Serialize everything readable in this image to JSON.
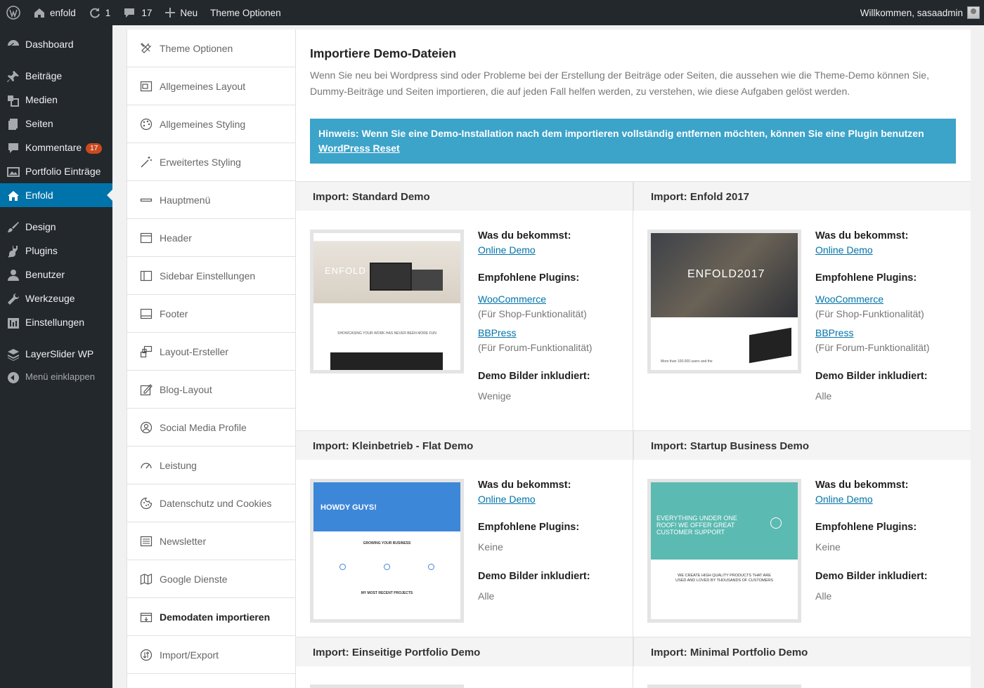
{
  "adminbar": {
    "site_name": "enfold",
    "updates_count": "1",
    "comments_count": "17",
    "new_label": "Neu",
    "theme_options_label": "Theme Optionen",
    "welcome": "Willkommen, sasaadmin"
  },
  "menu": [
    {
      "label": "Dashboard",
      "icon": "dashboard-icon"
    },
    {
      "label": "Beiträge",
      "icon": "pin-icon"
    },
    {
      "label": "Medien",
      "icon": "media-icon"
    },
    {
      "label": "Seiten",
      "icon": "pages-icon"
    },
    {
      "label": "Kommentare",
      "icon": "comment-icon",
      "badge": "17"
    },
    {
      "label": "Portfolio Einträge",
      "icon": "portfolio-icon"
    },
    {
      "label": "Enfold",
      "icon": "home-icon",
      "active": true
    },
    {
      "label": "Design",
      "icon": "brush-icon"
    },
    {
      "label": "Plugins",
      "icon": "plugin-icon"
    },
    {
      "label": "Benutzer",
      "icon": "user-icon"
    },
    {
      "label": "Werkzeuge",
      "icon": "wrench-icon"
    },
    {
      "label": "Einstellungen",
      "icon": "settings-icon"
    },
    {
      "label": "LayerSlider WP",
      "icon": "layers-icon"
    },
    {
      "label": "Menü einklappen",
      "icon": "collapse-icon"
    }
  ],
  "options_nav": [
    {
      "label": "Theme Optionen",
      "icon": "tools-icon"
    },
    {
      "label": "Allgemeines Layout",
      "icon": "layout-icon"
    },
    {
      "label": "Allgemeines Styling",
      "icon": "palette-icon"
    },
    {
      "label": "Erweitertes Styling",
      "icon": "magic-wand-icon"
    },
    {
      "label": "Hauptmenü",
      "icon": "menu-bar-icon"
    },
    {
      "label": "Header",
      "icon": "header-icon"
    },
    {
      "label": "Sidebar Einstellungen",
      "icon": "sidebar-icon"
    },
    {
      "label": "Footer",
      "icon": "footer-icon"
    },
    {
      "label": "Layout-Ersteller",
      "icon": "layout-builder-icon"
    },
    {
      "label": "Blog-Layout",
      "icon": "blog-icon"
    },
    {
      "label": "Social Media Profile",
      "icon": "social-icon"
    },
    {
      "label": "Leistung",
      "icon": "speedometer-icon"
    },
    {
      "label": "Datenschutz und Cookies",
      "icon": "cookie-icon"
    },
    {
      "label": "Newsletter",
      "icon": "newsletter-icon"
    },
    {
      "label": "Google Dienste",
      "icon": "map-icon"
    },
    {
      "label": "Demodaten importieren",
      "icon": "import-icon",
      "active": true
    },
    {
      "label": "Import/Export",
      "icon": "import-export-icon"
    }
  ],
  "page": {
    "title": "Importiere Demo-Dateien",
    "intro": "Wenn Sie neu bei Wordpress sind oder Probleme bei der Erstellung der Beiträge oder Seiten, die aussehen wie die Theme-Demo können Sie, Dummy-Beiträge und Seiten importieren, die auf jeden Fall helfen werden, zu verstehen, wie diese Aufgaben gelöst werden.",
    "notice_text": "Hinweis: Wenn Sie eine Demo-Installation nach dem importieren vollständig entfernen möchten, können Sie eine Plugin benutzen ",
    "notice_link": "WordPress Reset"
  },
  "labels": {
    "you_get": "Was du bekommst:",
    "online_demo": "Online Demo",
    "recommended_plugins": "Empfohlene Plugins:",
    "demo_images": "Demo Bilder inkludiert:"
  },
  "demos": [
    {
      "title": "Import: Standard Demo",
      "plugins": [
        {
          "name": "WooCommerce",
          "note": "(Für Shop-Funktionalität)"
        },
        {
          "name": "BBPress",
          "note": "(Für Forum-Funktionalität)"
        }
      ],
      "images": "Wenige",
      "thumb_text": "ENFOLD",
      "thumb_sub": "SHOWCASING YOUR WORK HAS NEVER BEEN MORE FUN"
    },
    {
      "title": "Import: Enfold 2017",
      "plugins": [
        {
          "name": "WooCommerce",
          "note": "(Für Shop-Funktionalität)"
        },
        {
          "name": "BBPress",
          "note": "(Für Forum-Funktionalität)"
        }
      ],
      "images": "Alle",
      "thumb_text": "ENFOLD2017",
      "thumb_sub": "More than 100.000 users and the"
    },
    {
      "title": "Import: Kleinbetrieb - Flat Demo",
      "plugins_none": "Keine",
      "images": "Alle",
      "thumb_text": "HOWDY GUYS!",
      "thumb_sub": "GROWING YOUR BUSINESS",
      "thumb_sub2": "MY MOST RECENT PROJECTS"
    },
    {
      "title": "Import: Startup Business Demo",
      "plugins_none": "Keine",
      "images": "Alle",
      "thumb_text": "EVERYTHING UNDER ONE ROOF! WE OFFER GREAT CUSTOMER SUPPORT",
      "thumb_sub": "WE CREATE HIGH QUALITY PRODUCTS THAT ARE USED AND LOVED BY THOUSANDS OF CUSTOMERS"
    },
    {
      "title": "Import: Einseitige Portfolio Demo"
    },
    {
      "title": "Import: Minimal Portfolio Demo"
    }
  ]
}
